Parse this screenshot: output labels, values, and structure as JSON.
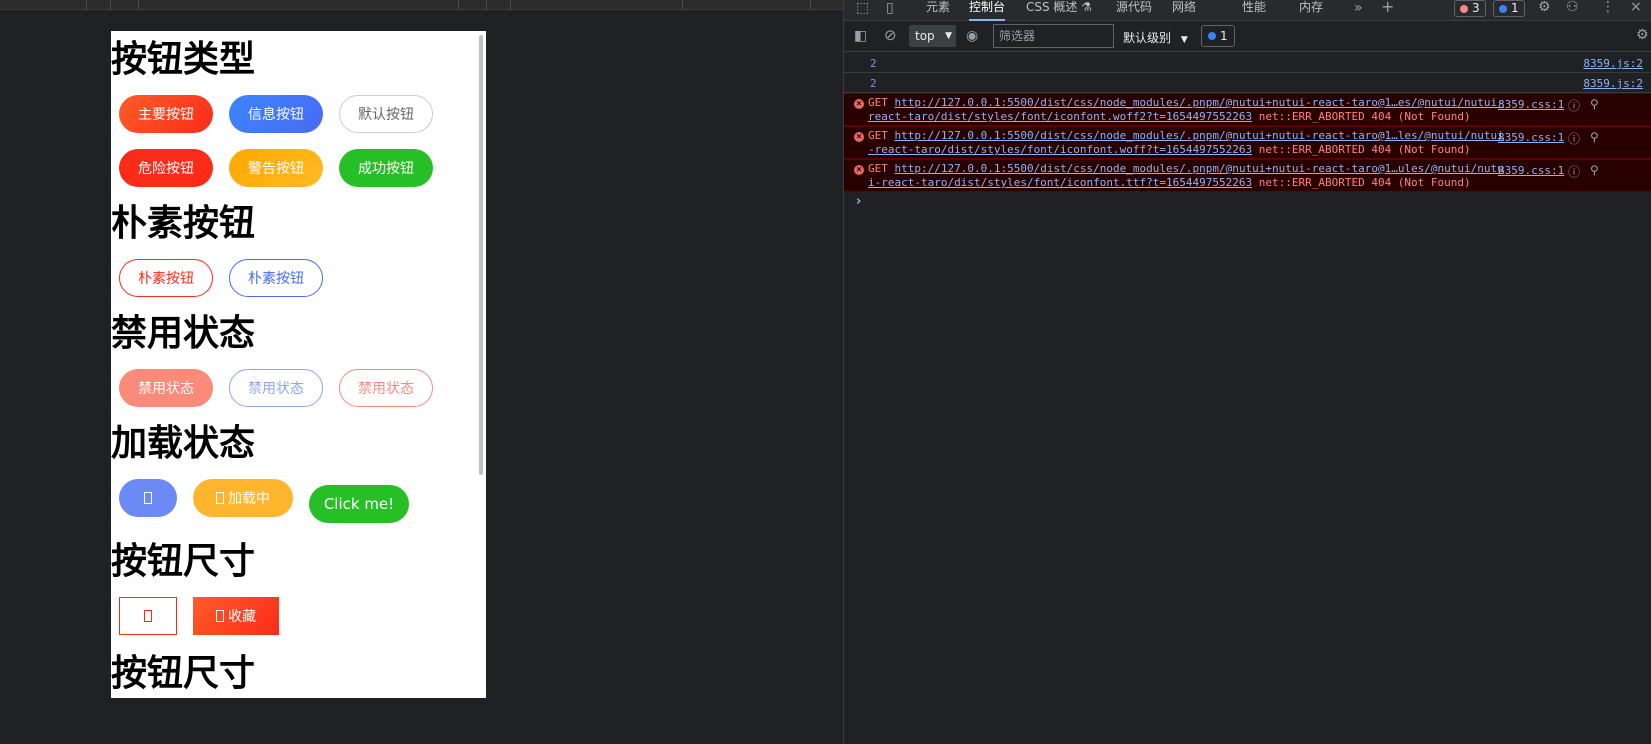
{
  "preview": {
    "sections": [
      {
        "title": "按钮类型"
      },
      {
        "title": "朴素按钮"
      },
      {
        "title": "禁用状态"
      },
      {
        "title": "加载状态"
      },
      {
        "title": "按钮尺寸"
      },
      {
        "title": "按钮尺寸"
      }
    ],
    "type_buttons": {
      "primary": "主要按钮",
      "info": "信息按钮",
      "default": "默认按钮",
      "danger": "危险按钮",
      "warning": "警告按钮",
      "success": "成功按钮"
    },
    "plain_buttons": {
      "plain_primary": "朴素按钮",
      "plain_info": "朴素按钮"
    },
    "disabled_buttons": {
      "primary": "禁用状态",
      "info": "禁用状态",
      "plain": "禁用状态"
    },
    "loading_buttons": {
      "loading_text": "加载中",
      "click_me": "Click me!"
    },
    "size_buttons": {
      "collect": "收藏"
    }
  },
  "devtools": {
    "tabs": [
      "元素",
      "控制台",
      "CSS 概述",
      "源代码",
      "网络",
      "性能",
      "内存"
    ],
    "active_tab": "控制台",
    "error_count": "3",
    "issue_count": "1",
    "toolbar": {
      "context": "top",
      "filter_placeholder": "筛选器",
      "level": "默认级别",
      "issues": "1"
    },
    "logs": [
      {
        "value": "2",
        "source": "8359.js:2"
      },
      {
        "value": "2",
        "source": "8359.js:2"
      }
    ],
    "errors": [
      {
        "method": "GET",
        "url": "http://127.0.0.1:5500/dist/css/node_modules/.pnpm/@nutui+nutui-react-taro@1…es/@nutui/nutui-react-taro/dist/styles/font/iconfont.woff2?t=1654497552263",
        "message": "net::ERR_ABORTED 404 (Not Found)",
        "source": "8359.css:1"
      },
      {
        "method": "GET",
        "url": "http://127.0.0.1:5500/dist/css/node_modules/.pnpm/@nutui+nutui-react-taro@1…les/@nutui/nutui-react-taro/dist/styles/font/iconfont.woff?t=1654497552263",
        "message": "net::ERR_ABORTED 404 (Not Found)",
        "source": "8359.css:1"
      },
      {
        "method": "GET",
        "url": "http://127.0.0.1:5500/dist/css/node_modules/.pnpm/@nutui+nutui-react-taro@1…ules/@nutui/nutui-react-taro/dist/styles/font/iconfont.ttf?t=1654497552263",
        "message": "net::ERR_ABORTED 404 (Not Found)",
        "source": "8359.css:1"
      }
    ]
  }
}
